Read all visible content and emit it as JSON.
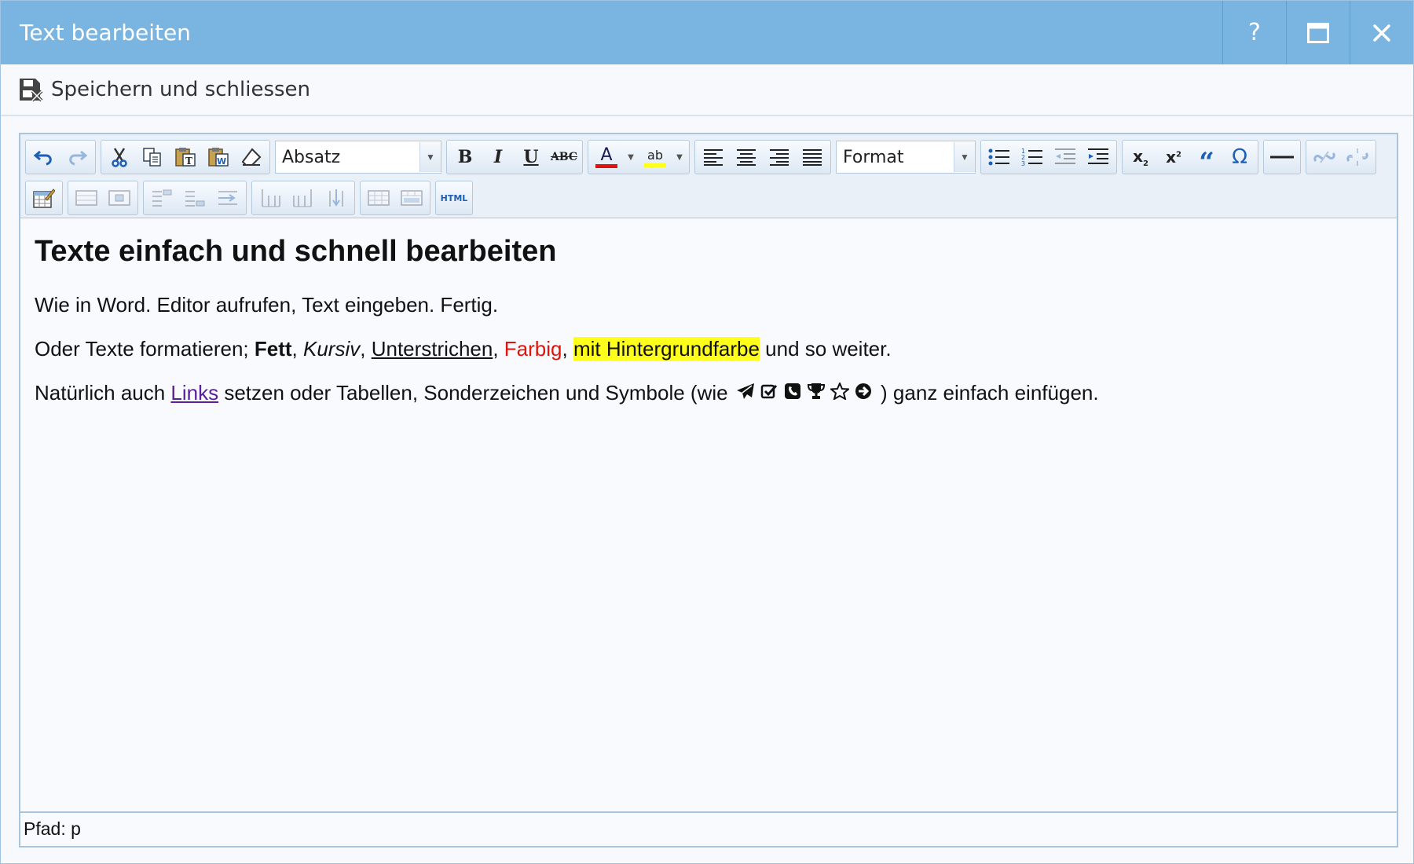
{
  "window": {
    "title": "Text bearbeiten",
    "help_label": "?",
    "maximize_icon": "maximize-icon",
    "close_icon": "close-icon"
  },
  "actionbar": {
    "save_close_label": "Speichern und schliessen",
    "save_close_icon": "save-close-icon"
  },
  "toolbar": {
    "paragraph_select": "Absatz",
    "format_select": "Format",
    "html_label": "HTML",
    "bold": "B",
    "italic": "I",
    "underline": "U",
    "strike": "ABC",
    "font_color": "A",
    "highlight": "ab",
    "quote": "“",
    "omega": "Ω",
    "colors": {
      "font_color_bar": "#e0140c",
      "highlight_bar": "#ffff1c"
    }
  },
  "content": {
    "heading": "Texte einfach und schnell bearbeiten",
    "p1": "Wie in Word. Editor aufrufen, Text eingeben. Fertig.",
    "p2": {
      "start": "Oder Texte formatieren; ",
      "bold": "Fett",
      "sep1": ", ",
      "italic": "Kursiv",
      "sep2": ", ",
      "underline": "Unterstrichen",
      "sep3": ", ",
      "colored": "Farbig",
      "sep4": ", ",
      "highlighted": "mit Hintergrundfarbe",
      "end": " und so weiter."
    },
    "p3": {
      "start": "Natürlich auch ",
      "link": "Links",
      "middle": " setzen oder Tabellen, Sonderzeichen und Symbole (wie ",
      "end": " ) ganz einfach einfügen.",
      "symbols": [
        "paper-plane-icon",
        "check-square-icon",
        "phone-square-icon",
        "trophy-icon",
        "star-outline-icon",
        "arrow-circle-right-icon"
      ]
    },
    "colors": {
      "red": "#e0140c",
      "highlight": "#ffff1c",
      "link": "#5b1e9c"
    }
  },
  "status": {
    "path_label": "Pfad: p"
  }
}
